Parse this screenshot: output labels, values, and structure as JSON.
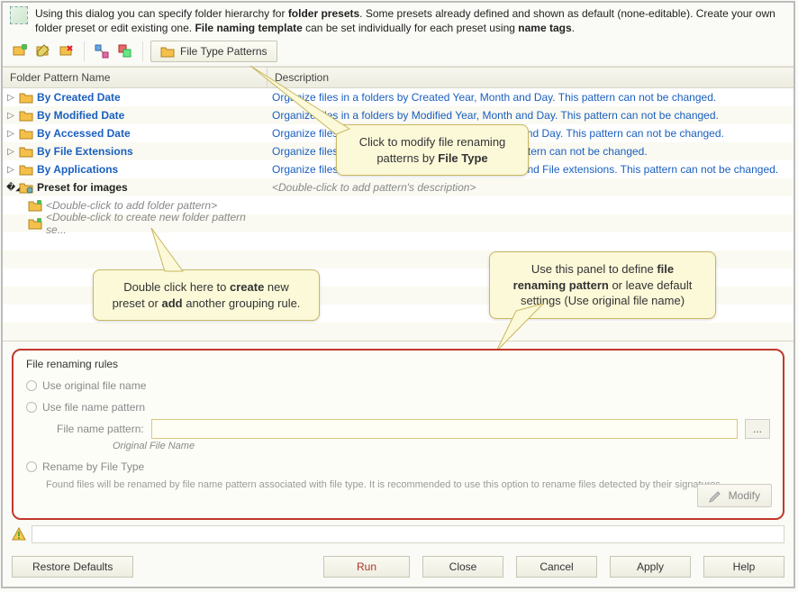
{
  "info": {
    "text_pre": "Using this dialog you can specify folder hierarchy for ",
    "bold1": "folder presets",
    "text_mid1": ". Some presets already defined and shown as default (none-editable). Create your own folder preset or edit existing one. ",
    "bold2": "File naming template",
    "text_mid2": " can be set individually for each preset using ",
    "bold3": "name tags",
    "text_end": "."
  },
  "toolbar": {
    "patterns_label": "File Type Patterns"
  },
  "grid": {
    "col_name": "Folder Pattern Name",
    "col_desc": "Description",
    "rows": [
      {
        "name": "By Created Date",
        "desc": "Organize files in a folders by Created Year, Month and Day. This pattern can not be changed."
      },
      {
        "name": "By Modified Date",
        "desc": "Organize files in a folders by Modified Year, Month and Day. This pattern can not be changed."
      },
      {
        "name": "By Accessed Date",
        "desc": "Organize files in a folders by Accessed Year, Month and Day. This pattern can not be changed."
      },
      {
        "name": "By File Extensions",
        "desc": "Organize files in a folders by File extensions. This pattern can not be changed."
      },
      {
        "name": "By Applications",
        "desc": "Organize files in a folders by associated Application and File extensions. This pattern can not be changed."
      }
    ],
    "custom_preset": {
      "name": "Preset for images",
      "desc": "<Double-click to add pattern's description>",
      "sub1": "<Double-click to add folder pattern>",
      "sub2": "<Double-click to create new folder pattern se..."
    }
  },
  "callouts": {
    "c1_line1": "Click to modify file renaming",
    "c1_line2a": "patterns by ",
    "c1_line2b": "File Type",
    "c2_line1a": "Use this panel to define ",
    "c2_line1b": "file",
    "c2_line2": "renaming pattern",
    "c2_line2b": " or leave default",
    "c2_line3": "settings (Use original file name)",
    "c3_line1a": "Double click here to ",
    "c3_line1b": "create",
    "c3_line1c": " new",
    "c3_line2a": "preset or ",
    "c3_line2b": "add",
    "c3_line2c": " another grouping rule."
  },
  "rename": {
    "legend": "File renaming rules",
    "opt1": "Use original file name",
    "opt2": "Use file name pattern",
    "pattern_label": "File name pattern:",
    "ofn_label": "Original File Name",
    "opt3": "Rename by File Type",
    "note": "Found files will be renamed by file name pattern associated with file type. It is recommended to use this option to rename files detected by their signatures.",
    "modify": "Modify",
    "dots": "..."
  },
  "buttons": {
    "restore": "Restore Defaults",
    "run": "Run",
    "close": "Close",
    "cancel": "Cancel",
    "apply": "Apply",
    "help": "Help"
  }
}
